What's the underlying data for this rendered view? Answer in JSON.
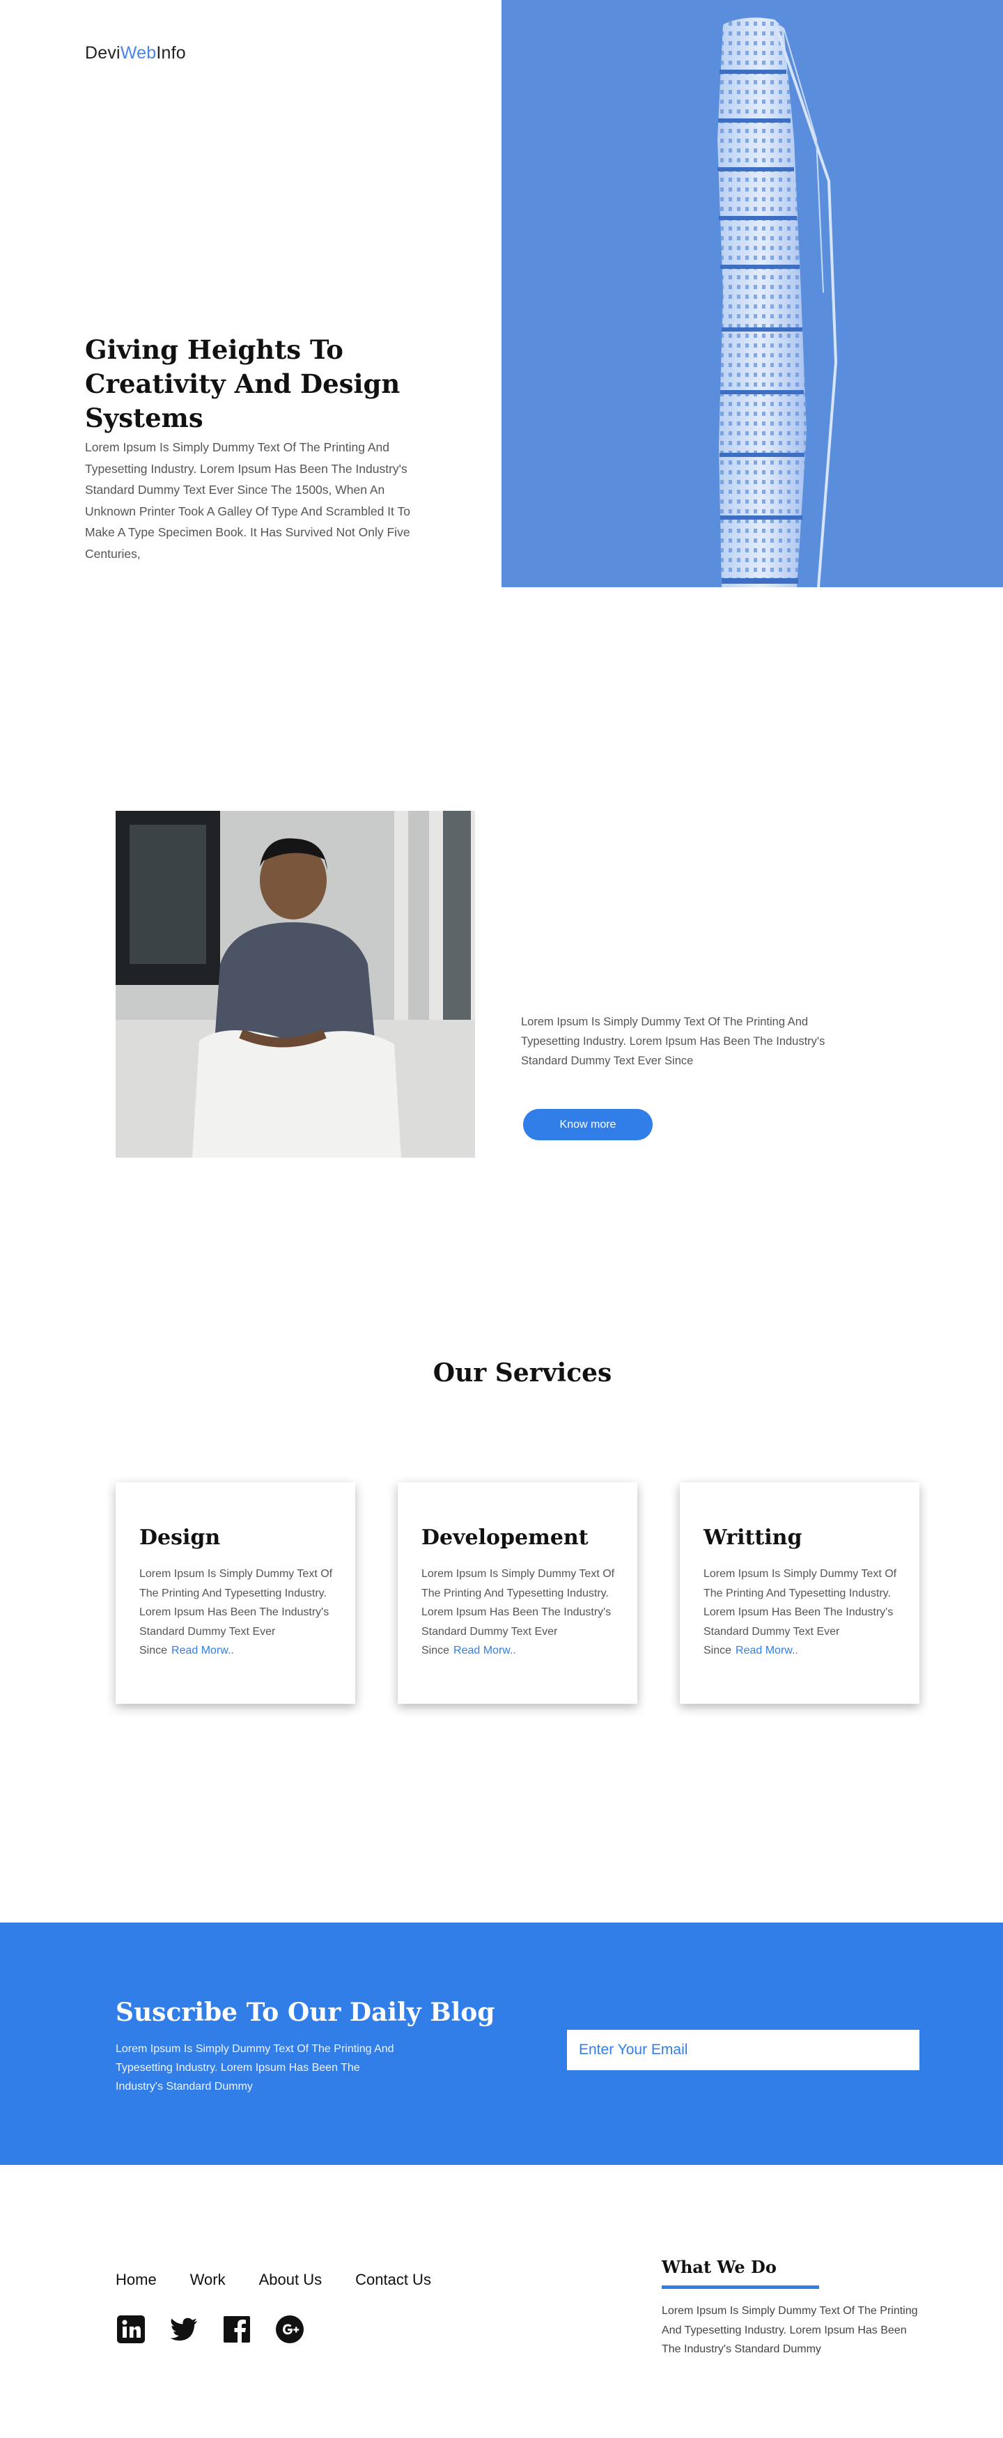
{
  "header": {
    "logo_part1": "Devi",
    "logo_part2": "Web",
    "logo_part3": "Info"
  },
  "hero": {
    "title": "Giving Heights To Creativity And Design Systems",
    "text": "Lorem Ipsum Is Simply Dummy Text Of The Printing And Typesetting Industry. Lorem Ipsum Has Been The Industry's Standard Dummy Text Ever Since The 1500s, When An Unknown Printer Took A Galley Of Type And Scrambled It To Make A Type Specimen Book. It Has Survived Not Only Five Centuries,"
  },
  "about": {
    "text": "Lorem Ipsum Is Simply Dummy Text Of The Printing And Typesetting Industry. Lorem Ipsum Has Been The Industry's Standard Dummy Text Ever Since",
    "button_label": "Know more"
  },
  "services": {
    "title": "Our Services",
    "cards": [
      {
        "title": "Design",
        "text": "Lorem Ipsum Is Simply Dummy Text Of The Printing And Typesetting Industry. Lorem Ipsum Has Been The Industry's Standard Dummy Text Ever Since",
        "link": "Read Morw.."
      },
      {
        "title": "Developement",
        "text": "Lorem Ipsum Is Simply Dummy Text Of The Printing And Typesetting Industry. Lorem Ipsum Has Been The Industry's Standard Dummy Text Ever Since",
        "link": "Read Morw.."
      },
      {
        "title": "Writting",
        "text": "Lorem Ipsum Is Simply Dummy Text Of The Printing And Typesetting Industry. Lorem Ipsum Has Been The Industry's Standard Dummy Text Ever Since",
        "link": "Read Morw.."
      }
    ]
  },
  "subscribe": {
    "title": "Suscribe To Our Daily Blog",
    "text": "Lorem Ipsum Is Simply Dummy Text Of The Printing And Typesetting Industry. Lorem Ipsum Has Been The Industry's Standard Dummy",
    "email_placeholder": "Enter Your Email"
  },
  "footer": {
    "nav": [
      "Home",
      "Work",
      "About Us",
      "Contact Us"
    ],
    "social_icons": [
      "linkedin-icon",
      "twitter-icon",
      "facebook-icon",
      "google-plus-icon"
    ],
    "what_we_do_title": "What We Do",
    "what_we_do_text": "Lorem Ipsum Is Simply Dummy Text Of The Printing And Typesetting Industry. Lorem Ipsum Has Been The Industry's Standard Dummy"
  },
  "colors": {
    "accent": "#317ee8",
    "hero_image_blue": "#5b8fdc",
    "text_dark": "#111111",
    "text_body": "#555555"
  }
}
